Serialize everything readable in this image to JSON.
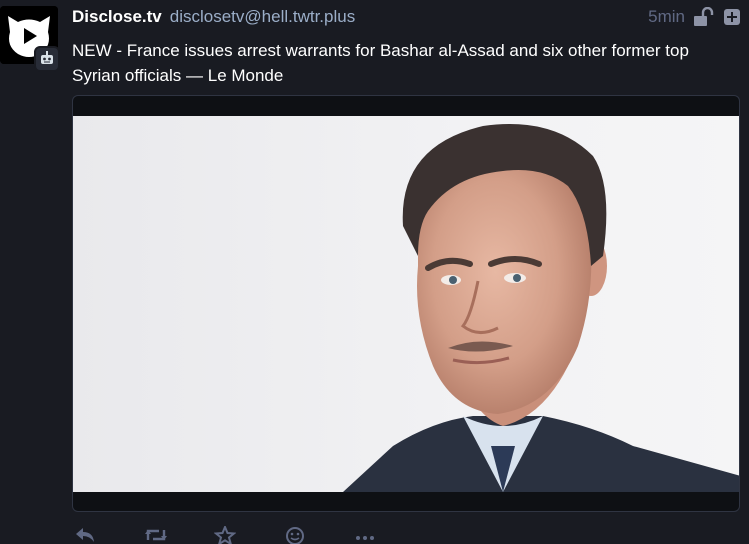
{
  "status": {
    "author": {
      "display_name": "Disclose.tv",
      "account": "disclosetv@hell.twtr.plus",
      "avatar_icon": "play-logo-icon",
      "bot_badge_icon": "robot-icon"
    },
    "timestamp": "5min",
    "visibility_icon": "unlock-icon",
    "more_icon": "plus-square-icon",
    "content": "NEW - France issues arrest warrants for Bashar al-Assad and six other former top Syrian officials — Le Monde",
    "media": {
      "type": "photo",
      "subject": "portrait-photo"
    },
    "actions": [
      {
        "name": "reply-button",
        "icon": "reply-icon"
      },
      {
        "name": "boost-button",
        "icon": "retweet-icon"
      },
      {
        "name": "favourite-button",
        "icon": "star-icon"
      },
      {
        "name": "emoji-reaction-button",
        "icon": "smile-icon"
      },
      {
        "name": "more-options-button",
        "icon": "ellipsis-icon"
      }
    ]
  },
  "colors": {
    "background": "#191b22",
    "display_name": "#ffffff",
    "account": "#9baec8",
    "muted": "#606984",
    "border": "#2f3442"
  }
}
